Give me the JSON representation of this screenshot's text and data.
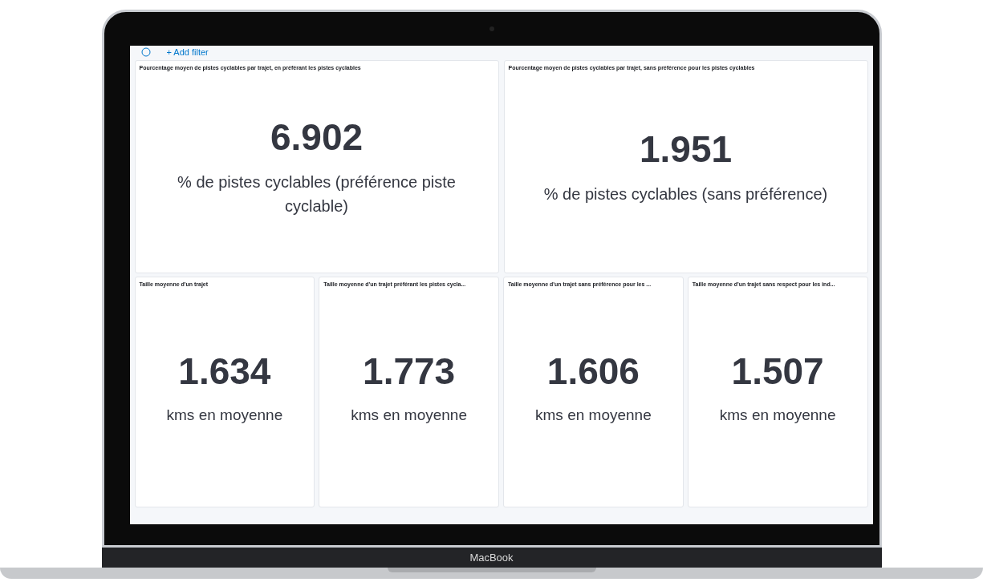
{
  "filter_bar": {
    "add_filter": "+ Add filter"
  },
  "top_row": [
    {
      "title": "Pourcentage moyen de pistes cyclables par trajet, en préférant les pistes cyclables",
      "value": "6.902",
      "label": "% de pistes cyclables (préférence piste cyclable)"
    },
    {
      "title": "Pourcentage moyen de pistes cyclables par trajet, sans préférence pour les pistes cyclables",
      "value": "1.951",
      "label": "% de pistes cyclables (sans préférence)"
    }
  ],
  "bottom_row": [
    {
      "title": "Taille moyenne d'un trajet",
      "value": "1.634",
      "label": "kms en moyenne"
    },
    {
      "title": "Taille moyenne d'un trajet préférant les pistes cycla...",
      "value": "1.773",
      "label": "kms en moyenne"
    },
    {
      "title": "Taille moyenne d'un trajet sans préférence pour les ...",
      "value": "1.606",
      "label": "kms en moyenne"
    },
    {
      "title": "Taille moyenne d'un trajet sans respect pour les ind...",
      "value": "1.507",
      "label": "kms en moyenne"
    }
  ],
  "device_label": "MacBook"
}
